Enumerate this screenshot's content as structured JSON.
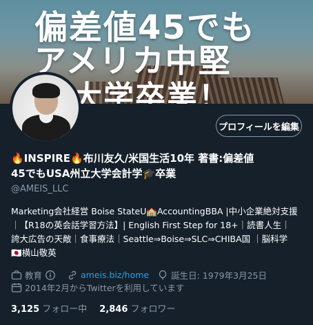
{
  "banner": {
    "line1": "偏差値45でも",
    "line2": "アメリカ中堅",
    "line3": "立大学卒業！"
  },
  "profile": {
    "edit_button": "プロフィールを編集",
    "name_line1": "INSPIRE",
    "name_line1_rest": "布川友久/米国生活10年 著書:偏差値",
    "name_line2": "45でもUSA州立大学会計学",
    "name_line2_end": "卒業",
    "handle": "@AMEIS_LLC",
    "bio_line1": "Marketing会社経営 Boise StateU🏫AccountingBBA |中小企業絶対支援",
    "bio_line2": "｜【R18の英会話学習方法】| English First Step for 18+｜読書人生｜",
    "bio_line3": "誇大広告の天敵｜食事療法｜Seattle⇒Boise⇒SLC⇒CHIBA国 ｜脳科学",
    "bio_line4": "🇯🇵横山敬英"
  },
  "meta": {
    "category": "教育",
    "category_icon": "briefcase-icon",
    "info_icon": "info-icon",
    "link": "ameis.biz/home",
    "link_icon": "link-icon",
    "birthday": "誕生日: 1979年3月25日",
    "birthday_icon": "balloon-icon",
    "joined": "2014年2月からTwitterを利用しています",
    "joined_icon": "calendar-icon"
  },
  "stats": {
    "following_count": "3,125",
    "following_label": "フォロー中",
    "followers_count": "2,846",
    "followers_label": "フォロワー"
  },
  "colors": {
    "background": "#15202b",
    "muted": "#8899a6",
    "link": "#1da1f2"
  }
}
